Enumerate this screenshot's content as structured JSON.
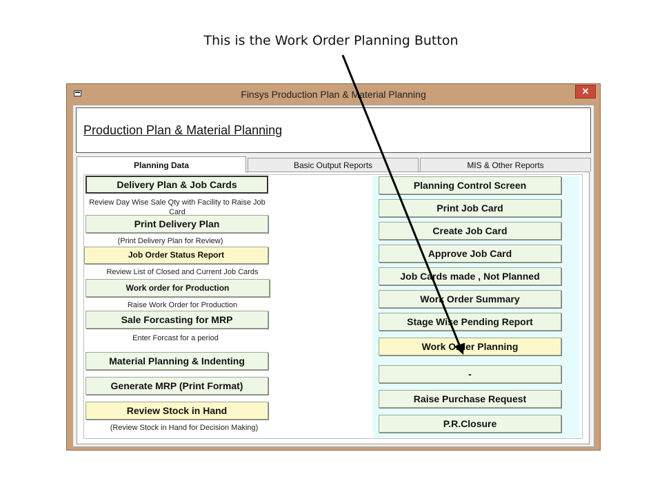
{
  "caption": "This is the Work Order Planning Button",
  "window": {
    "title": "Finsys Production Plan & Material Planning",
    "close": "✕",
    "header": "Production Plan & Material Planning"
  },
  "tabs": [
    "Planning Data",
    "Basic Output Reports",
    "MIS & Other Reports"
  ],
  "left": {
    "b1": "Delivery Plan & Job Cards",
    "d1": "Review Day Wise Sale Qty with Facility to Raise Job Card",
    "b2": "Print Delivery Plan",
    "d2": "(Print Delivery Plan for Review)",
    "b3": "Job Order Status Report",
    "d3": "Review List of Closed and Current Job Cards",
    "b4": "Work order for Production",
    "d4": "Raise Work Order for Production",
    "b5": "Sale Forcasting for MRP",
    "d5": "Enter Forcast for a period",
    "b6": "Material Planning & Indenting",
    "b7": "Generate MRP (Print Format)",
    "b8": "Review Stock in Hand",
    "d8": "(Review Stock in Hand for Decision Making)"
  },
  "right": [
    "Planning Control Screen",
    "Print Job Card",
    "Create Job Card",
    "Approve Job Card",
    "Job Cards made , Not Planned",
    "Work Order Summary",
    "Stage Wise Pending Report",
    "Work Order Planning",
    "-",
    "Raise Purchase Request",
    "P.R.Closure"
  ]
}
